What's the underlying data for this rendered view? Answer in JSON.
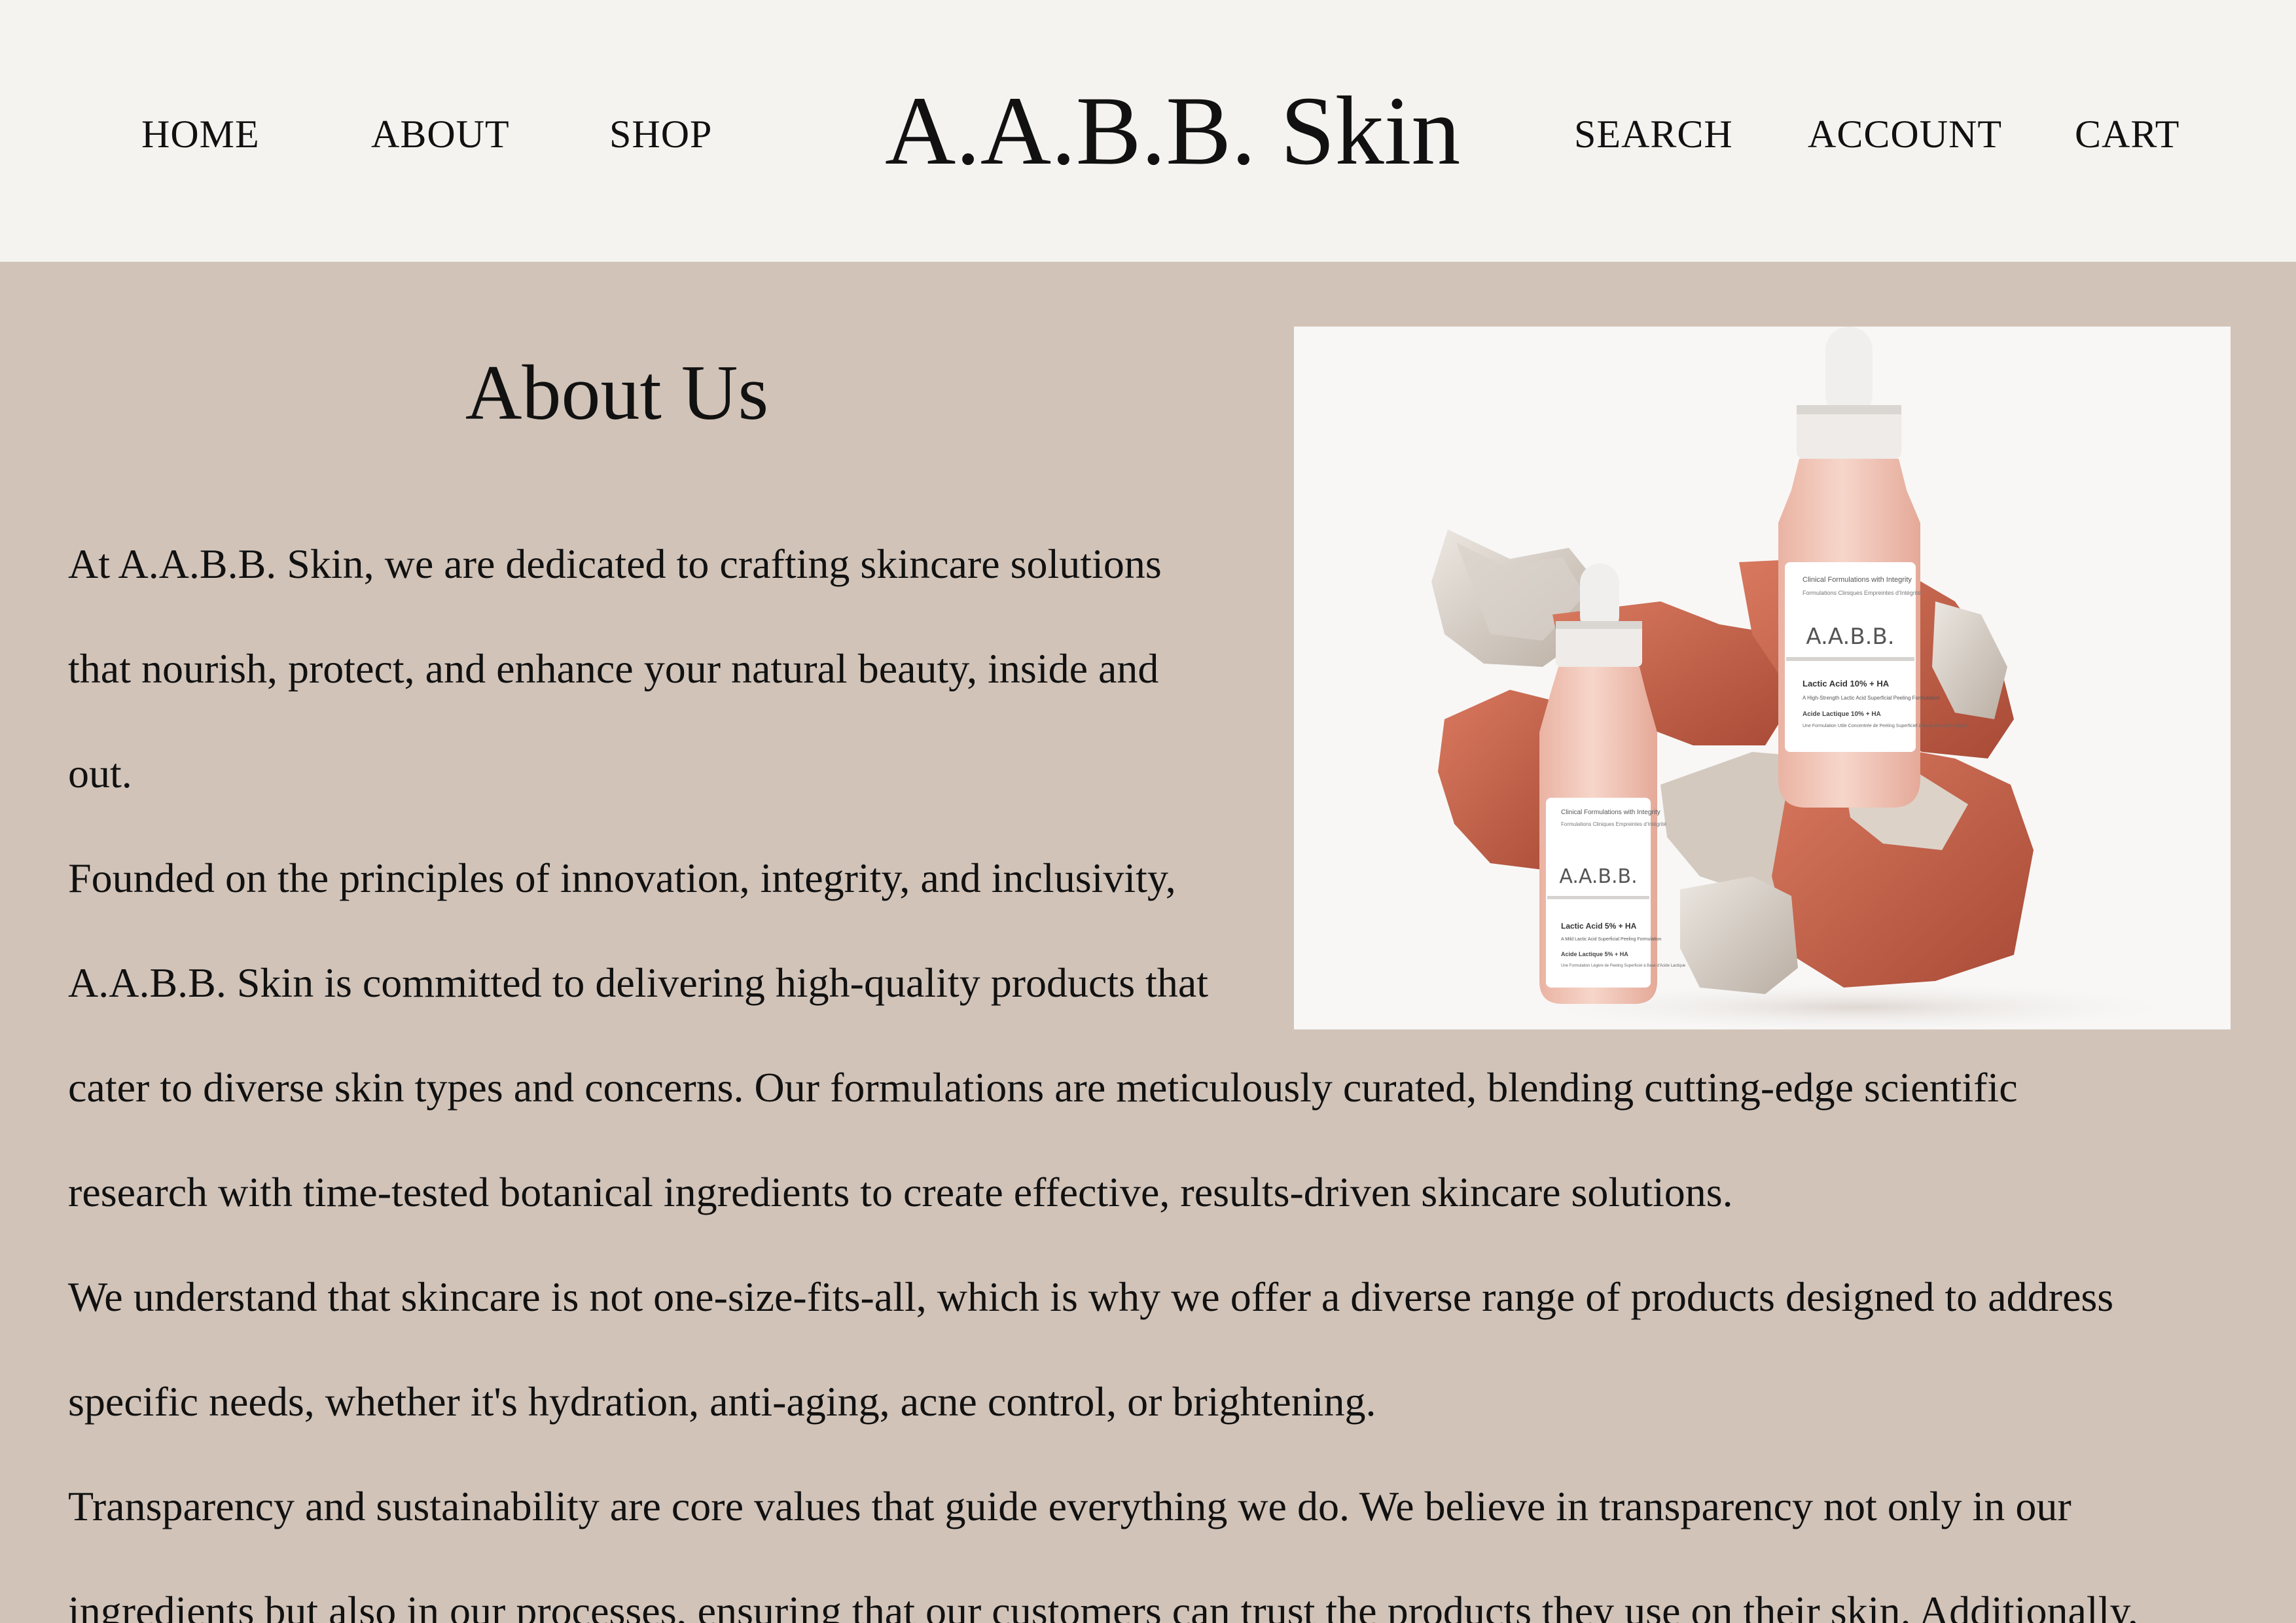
{
  "header": {
    "nav_left": [
      "HOME",
      "ABOUT",
      "SHOP"
    ],
    "brand": "A.A.B.B. Skin",
    "nav_right": [
      "SEARCH",
      "ACCOUNT",
      "CART"
    ]
  },
  "about": {
    "title": "About Us",
    "lines": [
      "At A.A.B.B. Skin, we are dedicated to crafting skincare solutions",
      "that nourish, protect, and enhance your natural beauty, inside and",
      "out.",
      "Founded on the principles of innovation, integrity, and inclusivity,",
      "A.A.B.B. Skin is committed to delivering high-quality products that",
      "cater to diverse skin types and concerns. Our formulations are meticulously curated, blending cutting-edge scientific",
      "research with time-tested botanical ingredients to create effective, results-driven skincare solutions.",
      "We understand that skincare is not one-size-fits-all, which is why we offer a diverse range of products designed to address",
      "specific needs, whether it's hydration, anti-aging, acne control, or brightening.",
      "Transparency and sustainability are core values that guide everything we do. We believe in transparency not only in our",
      "ingredients but also in our processes, ensuring that our customers can trust the products they use on their skin. Additionally,"
    ]
  },
  "product_image": {
    "large_bottle": {
      "tagline": "Clinical Formulations with Integrity",
      "tagline_fr": "Formulations Cliniques Empreintes d'Intégrité",
      "brand": "A.A.B.B.",
      "product": "Lactic Acid 10% + HA",
      "desc": "A High-Strength Lactic Acid Superficial Peeling Formulation",
      "product_fr": "Acide Lactique 10% + HA",
      "desc_fr": "Une Formulation Utile Concentrée de Peeling Superficiel à Base d'Acide Lactique"
    },
    "small_bottle": {
      "tagline": "Clinical Formulations with Integrity",
      "tagline_fr": "Formulations Cliniques Empreintes d'Intégrité",
      "brand": "A.A.B.B.",
      "product": "Lactic Acid 5% + HA",
      "desc": "A Mild Lactic Acid Superficial Peeling Formulation",
      "product_fr": "Acide Lactique 5% + HA",
      "desc_fr": "Une Formulation Légère de Peeling Superficiel à Base d'Acide Lactique"
    }
  }
}
